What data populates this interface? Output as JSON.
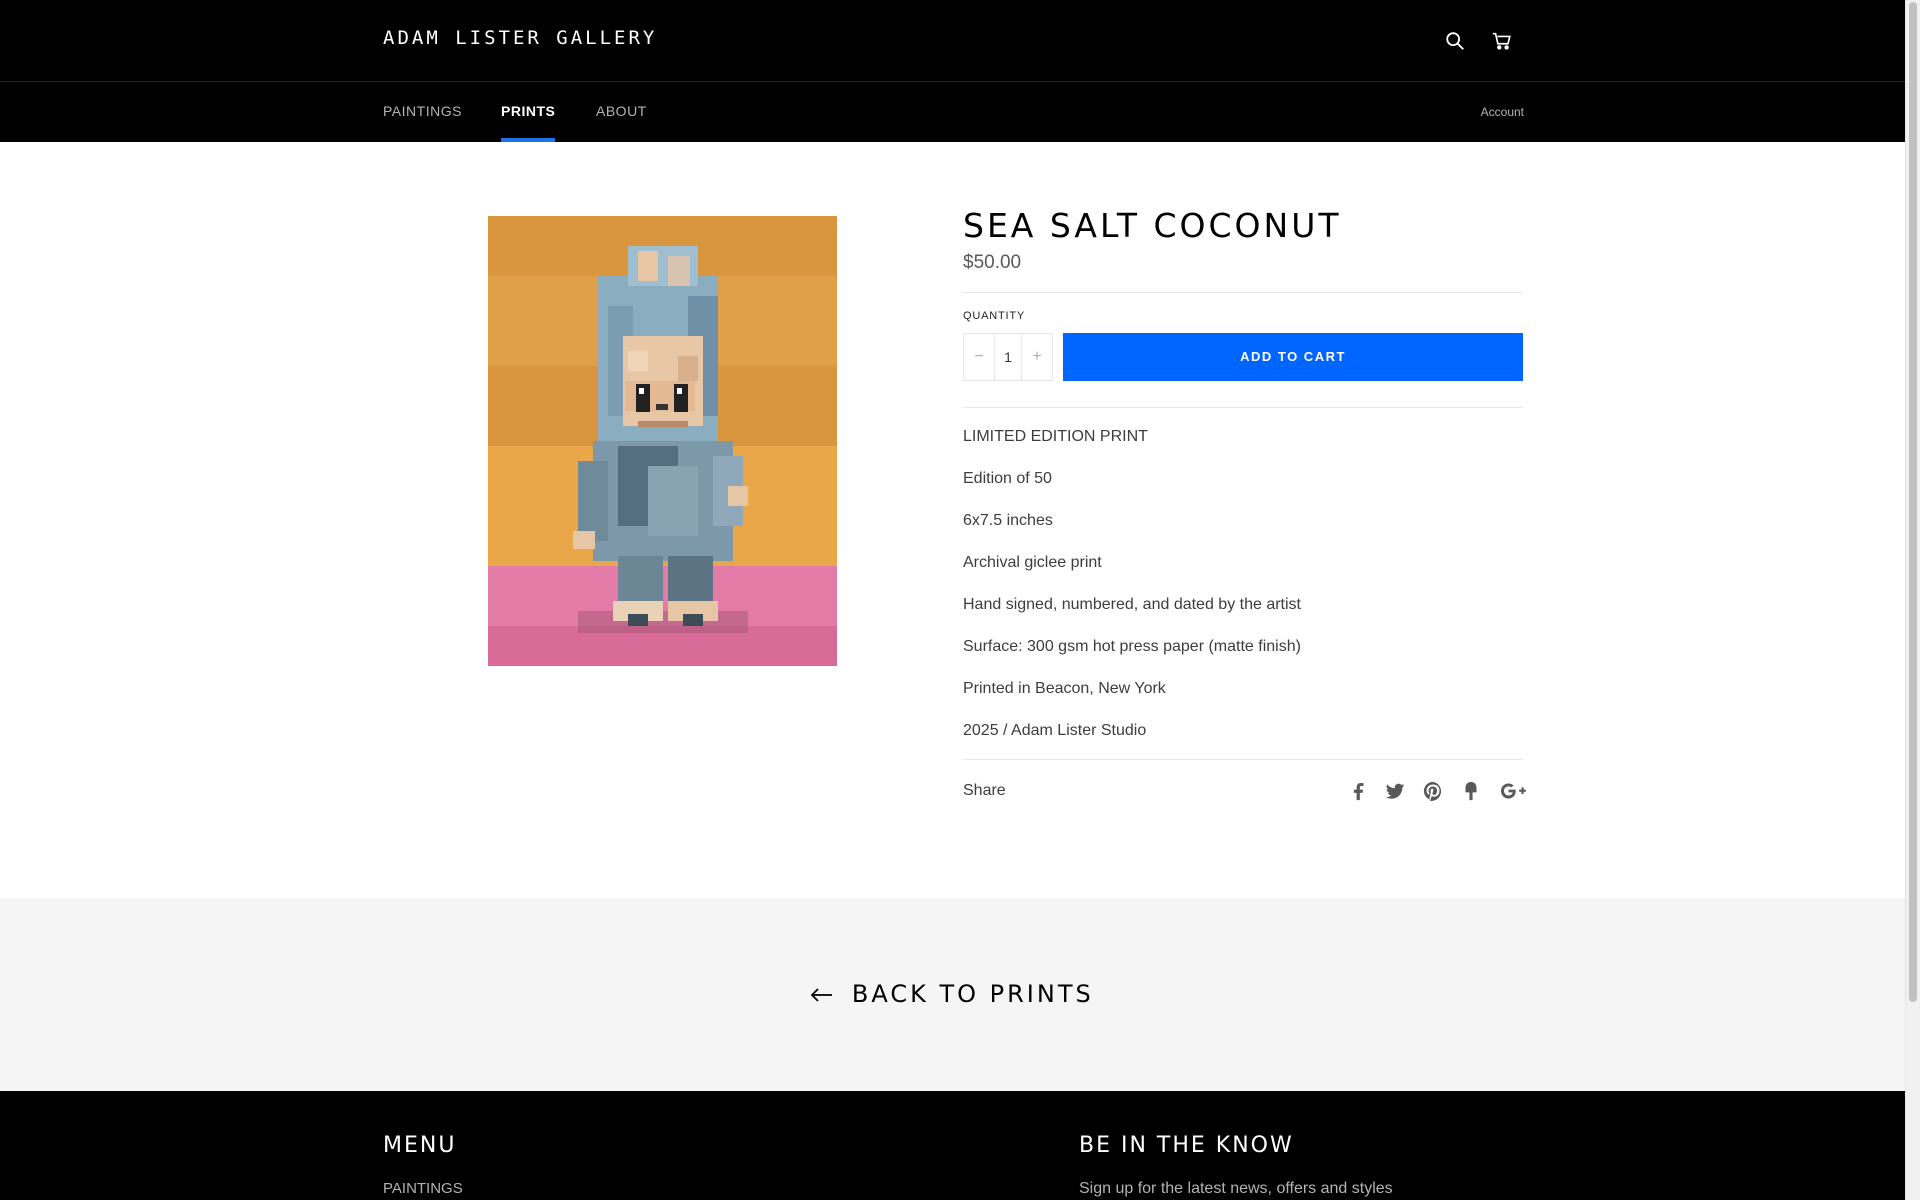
{
  "header": {
    "logo": "ADAM LISTER GALLERY",
    "icons": {
      "search": "search-icon",
      "cart": "cart-icon"
    }
  },
  "nav": {
    "items": [
      {
        "label": "PAINTINGS",
        "active": false
      },
      {
        "label": "PRINTS",
        "active": true
      },
      {
        "label": "ABOUT",
        "active": false
      }
    ],
    "account": "Account"
  },
  "product": {
    "title": "SEA SALT COCONUT",
    "price": "$50.00",
    "quantity_label": "QUANTITY",
    "quantity": "1",
    "minus": "−",
    "plus": "+",
    "add_to_cart": "ADD TO CART",
    "description": [
      "LIMITED EDITION PRINT",
      "Edition of 50",
      "6x7.5 inches",
      "Archival giclee print",
      "Hand signed, numbered, and dated by the artist",
      "Surface: 300 gsm hot press paper (matte finish)",
      "Printed in Beacon, New York",
      "2025 / Adam Lister Studio"
    ],
    "share_label": "Share",
    "share_icons": [
      "facebook-icon",
      "twitter-icon",
      "pinterest-icon",
      "fancy-icon",
      "google-plus-icon"
    ]
  },
  "back": {
    "label": "BACK TO PRINTS"
  },
  "footer": {
    "menu_title": "MENU",
    "menu_first": "PAINTINGS",
    "newsletter_title": "BE IN THE KNOW",
    "newsletter_text": "Sign up for the latest news, offers and styles"
  },
  "colors": {
    "accent": "#0066ff",
    "header_bg": "#000000",
    "nav_active_underline": "#1a73e8"
  }
}
